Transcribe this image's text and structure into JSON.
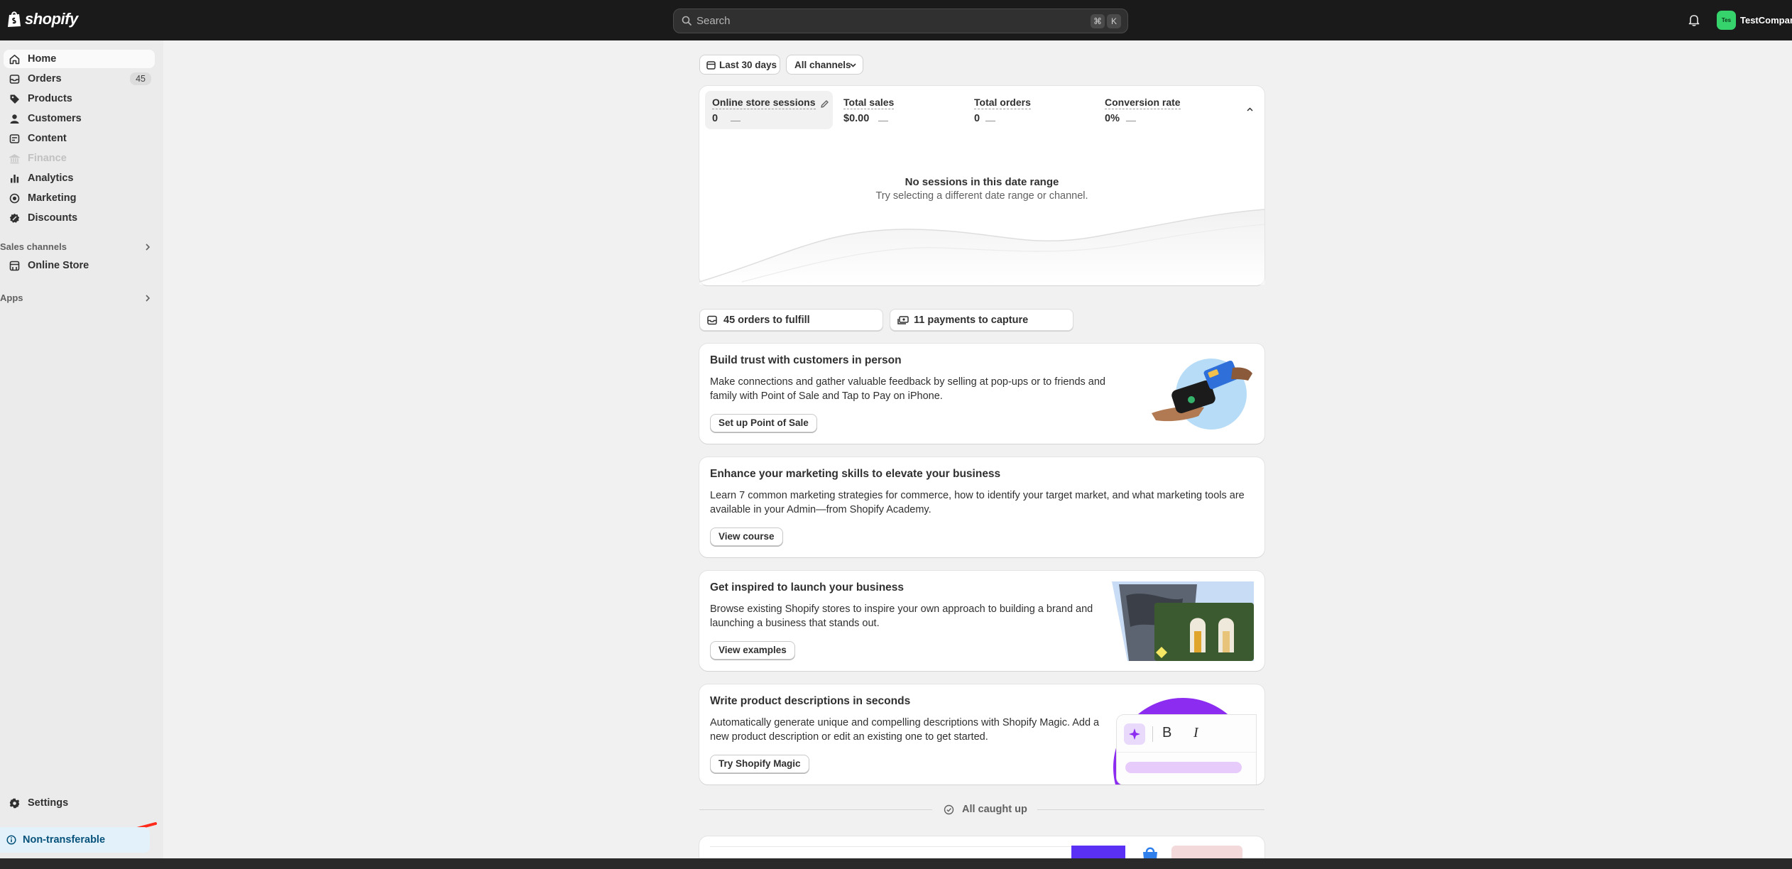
{
  "topbar": {
    "brand": "shopify",
    "search_placeholder": "Search",
    "shortcut_keys": [
      "⌘",
      "K"
    ],
    "store_initials": "Tes",
    "store_name": "TestCompany"
  },
  "sidebar": {
    "items": [
      {
        "label": "Home",
        "icon": "home-icon",
        "active": true
      },
      {
        "label": "Orders",
        "icon": "orders-icon",
        "badge": "45"
      },
      {
        "label": "Products",
        "icon": "tag-icon"
      },
      {
        "label": "Customers",
        "icon": "person-icon"
      },
      {
        "label": "Content",
        "icon": "content-icon"
      },
      {
        "label": "Finance",
        "icon": "bank-icon",
        "disabled": true
      },
      {
        "label": "Analytics",
        "icon": "bar-chart-icon"
      },
      {
        "label": "Marketing",
        "icon": "target-icon"
      },
      {
        "label": "Discounts",
        "icon": "discount-icon"
      }
    ],
    "sales_channels_label": "Sales channels",
    "online_store_label": "Online Store",
    "apps_label": "Apps",
    "settings_label": "Settings",
    "non_transferable_label": "Non-transferable",
    "accent_color": "#ff2a1a"
  },
  "filters": {
    "date_range": "Last 30 days",
    "channels": "All channels"
  },
  "metrics": [
    {
      "label": "Online store sessions",
      "value": "0",
      "trend": "—"
    },
    {
      "label": "Total sales",
      "value": "$0.00",
      "trend": "—"
    },
    {
      "label": "Total orders",
      "value": "0",
      "trend": "—"
    },
    {
      "label": "Conversion rate",
      "value": "0%",
      "trend": "—"
    }
  ],
  "empty_state": {
    "title": "No sessions in this date range",
    "subtitle": "Try selecting a different date range or channel."
  },
  "tasks": {
    "orders": "45 orders to fulfill",
    "payments": "11 payments to capture"
  },
  "promos": [
    {
      "title": "Build trust with customers in person",
      "body": "Make connections and gather valuable feedback by selling at pop-ups or to friends and family with Point of Sale and Tap to Pay on iPhone.",
      "button": "Set up Point of Sale"
    },
    {
      "title": "Enhance your marketing skills to elevate your business",
      "body": "Learn 7 common marketing strategies for commerce, how to identify your target market, and what marketing tools are available in your Admin—from Shopify Academy.",
      "button": "View course"
    },
    {
      "title": "Get inspired to launch your business",
      "body": "Browse existing Shopify stores to inspire your own approach to building a brand and launching a business that stands out.",
      "button": "View examples"
    },
    {
      "title": "Write product descriptions in seconds",
      "body": "Automatically generate unique and compelling descriptions with Shopify Magic. Add a new product description or edit an existing one to get started.",
      "button": "Try Shopify Magic"
    }
  ],
  "magic_toolbar": {
    "bold": "B",
    "italic": "I"
  },
  "caught_up": "All caught up"
}
